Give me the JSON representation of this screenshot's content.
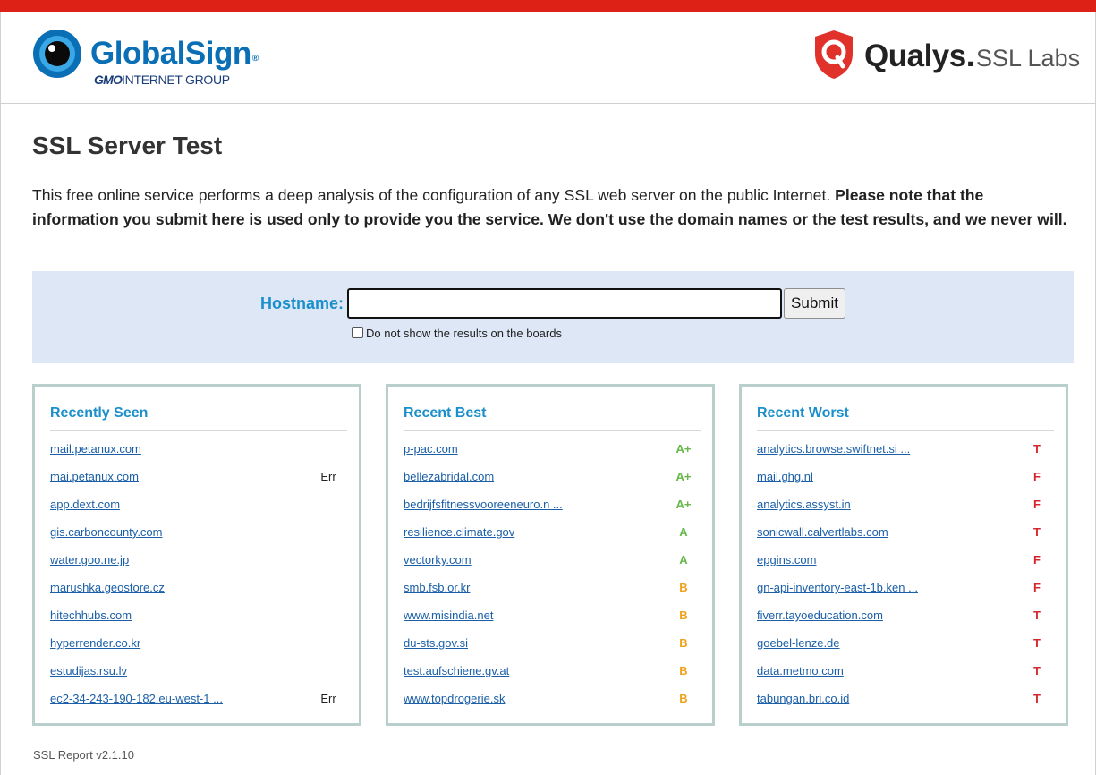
{
  "header": {
    "globalsign_name": "GlobalSign",
    "globalsign_reg": "®",
    "globalsign_group_prefix": "GMO",
    "globalsign_group": "INTERNET GROUP",
    "qualys_name": "Qualys.",
    "qualys_product": "SSL Labs"
  },
  "colors": {
    "top_bar": "#dd2116",
    "accent_blue": "#1a8fcb",
    "form_background": "#dee7f5",
    "grade_a": "#66b84a",
    "grade_b": "#f1a21c",
    "grade_fail": "#d6262c"
  },
  "page": {
    "title": "SSL Server Test",
    "intro_text": "This free online service performs a deep analysis of the configuration of any SSL web server on the public Internet. ",
    "intro_bold": "Please note that the information you submit here is used only to provide you the service. We don't use the domain names or the test results, and we never will."
  },
  "form": {
    "hostname_label": "Hostname:",
    "hostname_value": "",
    "submit_label": "Submit",
    "hide_results_label": "Do not show the results on the boards",
    "hide_results_checked": false
  },
  "panels": {
    "recently_seen": {
      "title": "Recently Seen",
      "items": [
        {
          "host": "mail.petanux.com",
          "grade": ""
        },
        {
          "host": "mai.petanux.com",
          "grade": "Err"
        },
        {
          "host": "app.dext.com",
          "grade": ""
        },
        {
          "host": "gis.carboncounty.com",
          "grade": ""
        },
        {
          "host": "water.goo.ne.jp",
          "grade": ""
        },
        {
          "host": "marushka.geostore.cz",
          "grade": ""
        },
        {
          "host": "hitechhubs.com",
          "grade": ""
        },
        {
          "host": "hyperrender.co.kr",
          "grade": ""
        },
        {
          "host": "estudijas.rsu.lv",
          "grade": ""
        },
        {
          "host": "ec2-34-243-190-182.eu-west-1 ...",
          "grade": "Err"
        }
      ]
    },
    "recent_best": {
      "title": "Recent Best",
      "items": [
        {
          "host": "p-pac.com",
          "grade": "A+"
        },
        {
          "host": "bellezabridal.com",
          "grade": "A+"
        },
        {
          "host": "bedrijfsfitnessvooreeneuro.n ...",
          "grade": "A+"
        },
        {
          "host": "resilience.climate.gov",
          "grade": "A"
        },
        {
          "host": "vectorky.com",
          "grade": "A"
        },
        {
          "host": "smb.fsb.or.kr",
          "grade": "B"
        },
        {
          "host": "www.misindia.net",
          "grade": "B"
        },
        {
          "host": "du-sts.gov.si",
          "grade": "B"
        },
        {
          "host": "test.aufschiene.gv.at",
          "grade": "B"
        },
        {
          "host": "www.topdrogerie.sk",
          "grade": "B"
        }
      ]
    },
    "recent_worst": {
      "title": "Recent Worst",
      "items": [
        {
          "host": "analytics.browse.swiftnet.si ...",
          "grade": "T"
        },
        {
          "host": "mail.ghg.nl",
          "grade": "F"
        },
        {
          "host": "analytics.assyst.in",
          "grade": "F"
        },
        {
          "host": "sonicwall.calvertlabs.com",
          "grade": "T"
        },
        {
          "host": "epgins.com",
          "grade": "F"
        },
        {
          "host": "gn-api-inventory-east-1b.ken ...",
          "grade": "F"
        },
        {
          "host": "fiverr.tayoeducation.com",
          "grade": "T"
        },
        {
          "host": "goebel-lenze.de",
          "grade": "T"
        },
        {
          "host": "data.metmo.com",
          "grade": "T"
        },
        {
          "host": "tabungan.bri.co.id",
          "grade": "T"
        }
      ]
    }
  },
  "footer": {
    "version": "SSL Report v2.1.10"
  }
}
